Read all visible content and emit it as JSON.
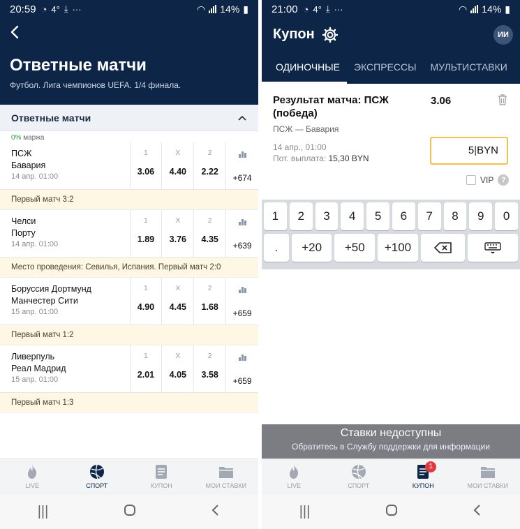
{
  "left": {
    "status": {
      "time": "20:59",
      "temp": "4°",
      "battery": "14%"
    },
    "header": {
      "back_icon": "chevron-left-icon",
      "title": "Ответные матчи",
      "subtitle": "Футбол. Лига чемпионов UEFA. 1/4 финала."
    },
    "section": {
      "title": "Ответные матчи"
    },
    "margin": {
      "pct": "0%",
      "label": " маржа"
    },
    "matches": [
      {
        "team1": "ПСЖ",
        "team2": "Бавария",
        "date": "14 апр. 01:00",
        "labels": [
          "1",
          "X",
          "2"
        ],
        "odds": [
          "3.06",
          "4.40",
          "2.22"
        ],
        "more": "+674",
        "note": "Первый матч 3:2"
      },
      {
        "team1": "Челси",
        "team2": "Порту",
        "date": "14 апр. 01:00",
        "labels": [
          "1",
          "X",
          "2"
        ],
        "odds": [
          "1.89",
          "3.76",
          "4.35"
        ],
        "more": "+639",
        "note": "Место проведения: Севилья, Испания. Первый матч 2:0"
      },
      {
        "team1": "Боруссия Дортмунд",
        "team2": "Манчестер Сити",
        "date": "15 апр. 01:00",
        "labels": [
          "1",
          "X",
          "2"
        ],
        "odds": [
          "4.90",
          "4.45",
          "1.68"
        ],
        "more": "+659",
        "note": "Первый матч 1:2"
      },
      {
        "team1": "Ливерпуль",
        "team2": "Реал Мадрид",
        "date": "15 апр. 01:00",
        "labels": [
          "1",
          "X",
          "2"
        ],
        "odds": [
          "2.01",
          "4.05",
          "3.58"
        ],
        "more": "+659",
        "note": "Первый матч 1:3"
      }
    ],
    "nav": [
      {
        "label": "LIVE",
        "icon": "flame-icon"
      },
      {
        "label": "СПОРТ",
        "icon": "ball-icon"
      },
      {
        "label": "КУПОН",
        "icon": "coupon-icon"
      },
      {
        "label": "МОИ СТАВКИ",
        "icon": "folder-icon"
      }
    ]
  },
  "right": {
    "status": {
      "time": "21:00",
      "temp": "4°",
      "battery": "14%"
    },
    "header": {
      "title": "Купон",
      "avatar": "ИИ"
    },
    "tabs": [
      "ОДИНОЧНЫЕ",
      "ЭКСПРЕССЫ",
      "МУЛЬТИСТАВКИ"
    ],
    "bet": {
      "title": "Результат матча: ПСЖ (победа)",
      "odd": "3.06",
      "match": "ПСЖ — Бавария",
      "date": "14 апр., 01:00",
      "payout_label": "Пот. выплата: ",
      "payout_value": "15,30 BYN",
      "stake": "5",
      "currency": "BYN",
      "vip": "VIP"
    },
    "keypad": {
      "row1": [
        "1",
        "2",
        "3",
        "4",
        "5",
        "6",
        "7",
        "8",
        "9",
        "0"
      ],
      "row2": [
        ".",
        "+20",
        "+50",
        "+100"
      ]
    },
    "unavailable": {
      "title": "Ставки недоступны",
      "message": "Обратитесь в Службу поддержки для информации"
    },
    "nav": [
      {
        "label": "LIVE",
        "icon": "flame-icon"
      },
      {
        "label": "СПОРТ",
        "icon": "ball-icon"
      },
      {
        "label": "КУПОН",
        "icon": "coupon-icon",
        "badge": "1"
      },
      {
        "label": "МОИ СТАВКИ",
        "icon": "folder-icon"
      }
    ]
  },
  "colors": {
    "navy": "#0d2547",
    "note_bg": "#fdf7e3",
    "accent_input": "#f0c050",
    "badge": "#e0393e",
    "margin_green": "#2a9d4a"
  }
}
